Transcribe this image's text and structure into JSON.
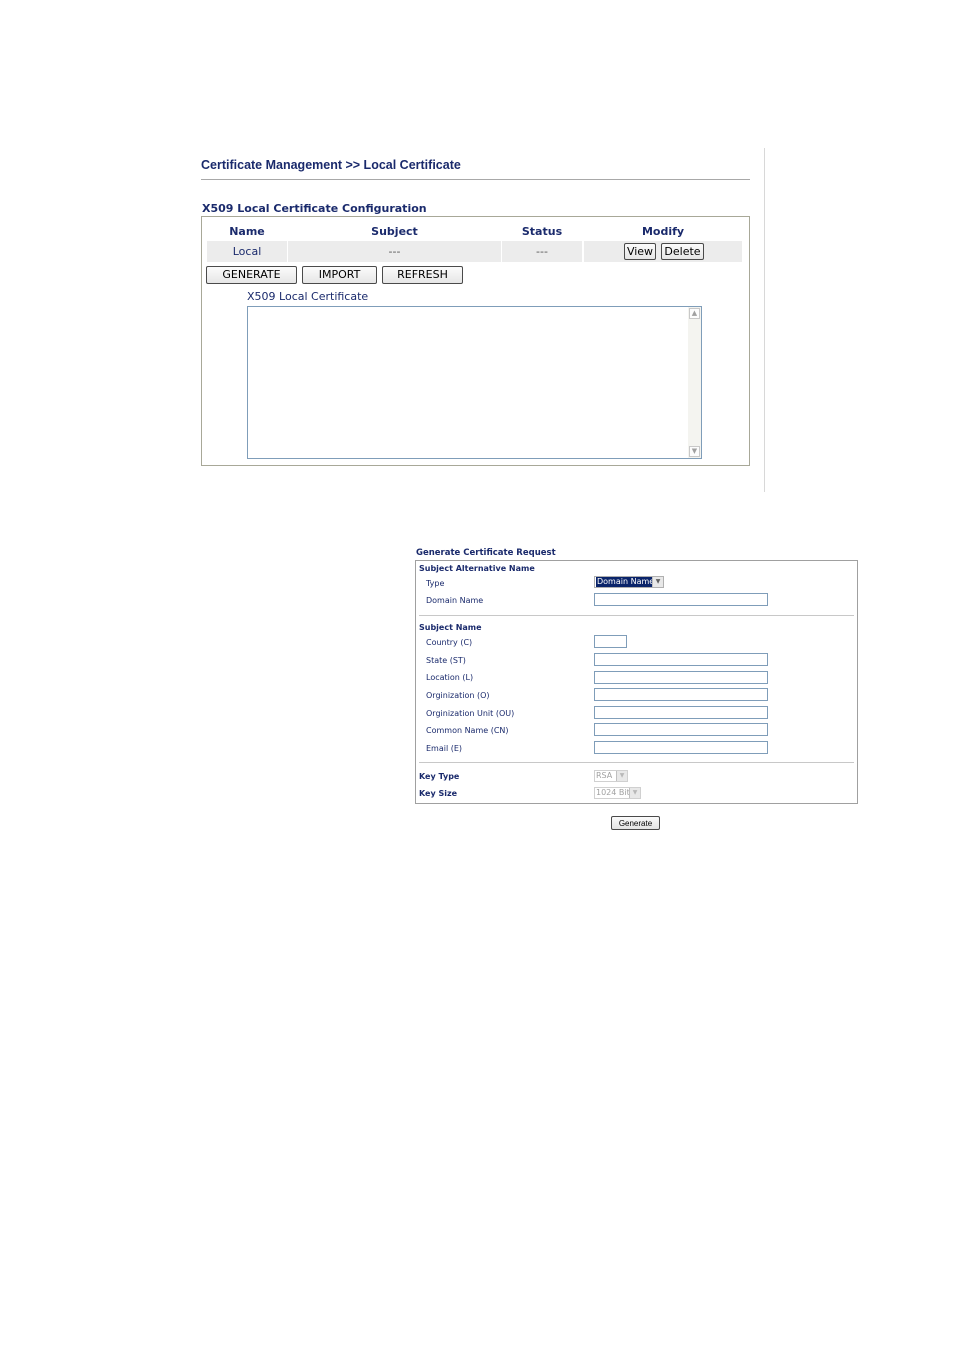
{
  "local_certificate": {
    "breadcrumb": "Certificate Management >> Local Certificate",
    "section_title": "X509 Local Certificate Configuration",
    "table": {
      "headers": [
        "Name",
        "Subject",
        "Status",
        "Modify"
      ],
      "row": {
        "name": "Local",
        "subject": "---",
        "status": "---"
      },
      "view_label": "View",
      "delete_label": "Delete"
    },
    "actions": {
      "generate": "GENERATE",
      "import": "IMPORT",
      "refresh": "REFRESH"
    },
    "certificate_label": "X509 Local Certificate",
    "certificate_text": ""
  },
  "generate_request": {
    "title": "Generate Certificate Request",
    "subject_alt_heading": "Subject Alternative Name",
    "type_label": "Type",
    "type_value": "Domain Name",
    "domain_name_label": "Domain Name",
    "subject_name_heading": "Subject Name",
    "fields": [
      "Country (C)",
      "State (ST)",
      "Location (L)",
      "Orginization (O)",
      "Orginization Unit (OU)",
      "Common Name (CN)",
      "Email (E)"
    ],
    "key_type_label": "Key Type",
    "key_type_value": "RSA",
    "key_size_label": "Key Size",
    "key_size_value": "1024 Bit",
    "generate_label": "Generate"
  }
}
